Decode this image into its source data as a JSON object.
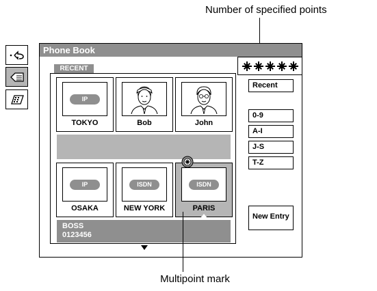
{
  "callouts": {
    "top": "Number of specified points",
    "bottom": "Multipoint mark"
  },
  "sidebar": {
    "items": [
      {
        "icon": "back-arrow-icon",
        "active": false
      },
      {
        "icon": "phone-book-icon",
        "active": true
      },
      {
        "icon": "phone-keypad-icon",
        "active": false
      }
    ]
  },
  "window": {
    "title": "Phone Book",
    "tab_label": "RECENT"
  },
  "entries": [
    {
      "name": "TOKYO",
      "type": "IP",
      "photo": false,
      "selected": false
    },
    {
      "name": "Bob",
      "type": "",
      "photo": true,
      "selected": false
    },
    {
      "name": "John",
      "type": "",
      "photo": true,
      "selected": false
    },
    {
      "name": "OSAKA",
      "type": "IP",
      "photo": false,
      "selected": false
    },
    {
      "name": "NEW YORK",
      "type": "ISDN",
      "photo": false,
      "selected": false
    },
    {
      "name": "PARIS",
      "type": "ISDN",
      "photo": false,
      "selected": true
    }
  ],
  "info": {
    "line1": "BOSS",
    "line2": "0123456"
  },
  "buttons": {
    "recent": "Recent",
    "range_0_9": "0-9",
    "range_a_i": "A-I",
    "range_j_s": "J-S",
    "range_t_z": "T-Z",
    "new_entry": "New Entry"
  },
  "colors": {
    "dark_gray": "#8f8f8f",
    "light_gray": "#b5b5b5"
  }
}
